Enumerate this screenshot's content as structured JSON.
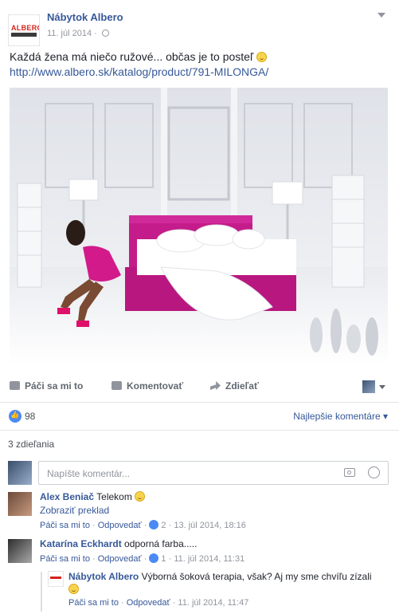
{
  "post": {
    "page_name": "Nábytok Albero",
    "logo_text": "ALBERO",
    "date": "11. júl 2014 · ",
    "text": "Každá žena má niečo ružové... občas je to posteľ ",
    "link": "http://www.albero.sk/katalog/product/791-MILONGA/"
  },
  "actions": {
    "like": "Páči sa mi to",
    "comment": "Komentovať",
    "share": "Zdieľať"
  },
  "reactions": {
    "count": "98",
    "sort_label": "Najlepšie komentáre ▾"
  },
  "shares": "3 zdieľania",
  "composer": {
    "placeholder": "Napíšte komentár..."
  },
  "comments": [
    {
      "author": "Alex Beniač",
      "text": " Telekom ",
      "translate": "Zobraziť preklad",
      "like": "Páči sa mi to",
      "reply": "Odpovedať",
      "like_count": "2",
      "date": "13. júl 2014, 18:16"
    },
    {
      "author": "Katarína Eckhardt",
      "text": " odporná farba.....",
      "like": "Páči sa mi to",
      "reply": "Odpovedať",
      "like_count": "1",
      "date": "11. júl 2014, 11:31"
    }
  ],
  "reply": {
    "author": "Nábytok Albero",
    "text": " Výborná šoková terapia, však? Aj my sme chvíľu zízali",
    "like": "Páči sa mi to",
    "reply": "Odpovedať",
    "date": "11. júl 2014, 11:47"
  },
  "separator": " · "
}
